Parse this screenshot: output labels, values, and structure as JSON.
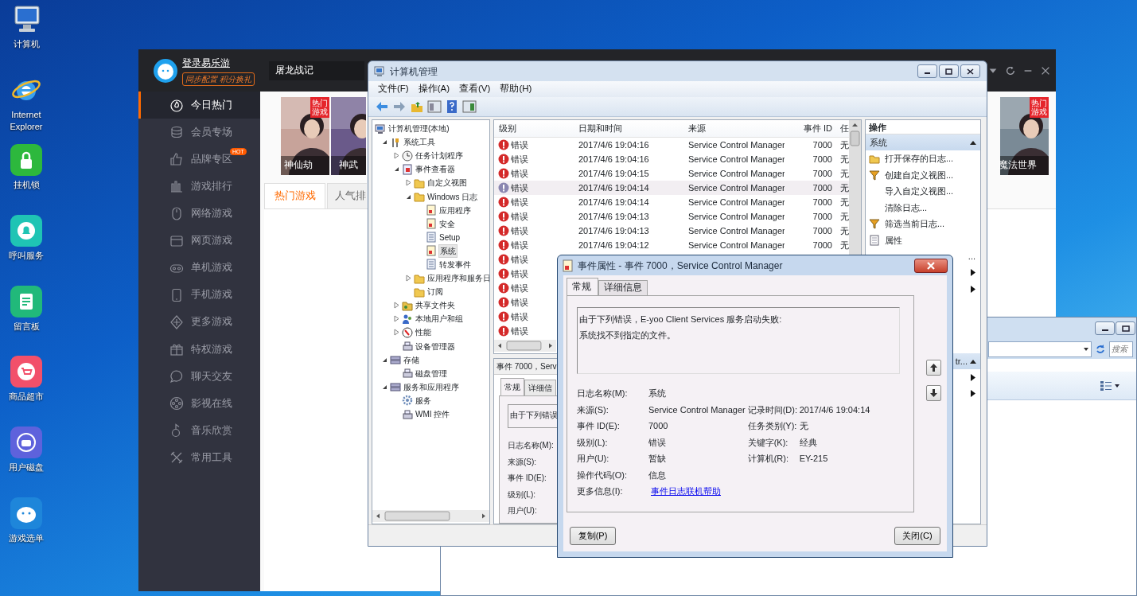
{
  "desktop_icons": [
    {
      "label": "计算机",
      "kind": "monitor"
    },
    {
      "label": "Internet Explorer",
      "kind": "browser"
    },
    {
      "label": "挂机锁",
      "kind": "tile",
      "color": "#2db83d"
    },
    {
      "label": "呼叫服务",
      "kind": "tile",
      "color": "#1fc4b4"
    },
    {
      "label": "留言板",
      "kind": "tile",
      "color": "#21b97a"
    },
    {
      "label": "商品超市",
      "kind": "tile",
      "color": "#f2506a"
    },
    {
      "label": "用户磁盘",
      "kind": "tile",
      "color": "#5e62dc"
    },
    {
      "label": "游戏选单",
      "kind": "tile",
      "color": "#1e86da"
    }
  ],
  "launcher": {
    "login": "登录易乐游",
    "slogan": "同步配置 积分换礼",
    "search": {
      "value": "屠龙战记"
    },
    "menu": [
      {
        "label": "今日热门",
        "selected": true
      },
      {
        "label": "会员专场",
        "selected": false
      },
      {
        "label": "品牌专区",
        "selected": false,
        "badge": "HOT"
      },
      {
        "label": "游戏排行",
        "selected": false
      },
      {
        "label": "网络游戏",
        "selected": false
      },
      {
        "label": "网页游戏",
        "selected": false
      },
      {
        "label": "单机游戏",
        "selected": false
      },
      {
        "label": "手机游戏",
        "selected": false
      },
      {
        "label": "更多游戏",
        "selected": false
      },
      {
        "label": "特权游戏",
        "selected": false
      },
      {
        "label": "聊天交友",
        "selected": false
      },
      {
        "label": "影视在线",
        "selected": false
      },
      {
        "label": "音乐欣赏",
        "selected": false
      },
      {
        "label": "常用工具",
        "selected": false
      }
    ],
    "games": [
      {
        "title": "神仙劫",
        "tag": "热门游戏",
        "color": "#c7a39a"
      },
      {
        "title": "神武",
        "color": "#6a5a8a"
      },
      {
        "title": "魔法世界",
        "tag": "热门游戏",
        "color": "#7a8a96"
      }
    ],
    "tabs": [
      {
        "label": "热门游戏",
        "selected": true
      },
      {
        "label": "人气排",
        "selected": false
      }
    ]
  },
  "explorer": {
    "search": {
      "placeholder": "搜索"
    }
  },
  "computer_management": {
    "title": "计算机管理",
    "menu": [
      "文件(F)",
      "操作(A)",
      "查看(V)",
      "帮助(H)"
    ],
    "tree": [
      {
        "label": "计算机管理(本地)",
        "kind": "computer",
        "selected": false,
        "children": [
          {
            "label": "系统工具",
            "kind": "tools",
            "expanded": true,
            "selected": false,
            "children": [
              {
                "label": "任务计划程序",
                "kind": "clock",
                "expanded": false,
                "selected": false
              },
              {
                "label": "事件查看器",
                "kind": "viewer",
                "expanded": true,
                "selected": false,
                "children": [
                  {
                    "label": "自定义视图",
                    "kind": "folder",
                    "expanded": false,
                    "selected": false
                  },
                  {
                    "label": "Windows 日志",
                    "kind": "folder",
                    "expanded": true,
                    "selected": false,
                    "children": [
                      {
                        "label": "应用程序",
                        "kind": "log",
                        "selected": false
                      },
                      {
                        "label": "安全",
                        "kind": "log",
                        "selected": false
                      },
                      {
                        "label": "Setup",
                        "kind": "list",
                        "selected": false
                      },
                      {
                        "label": "系统",
                        "kind": "log",
                        "selected": true
                      },
                      {
                        "label": "转发事件",
                        "kind": "list",
                        "selected": false
                      }
                    ]
                  },
                  {
                    "label": "应用程序和服务日",
                    "kind": "folder",
                    "expanded": false,
                    "selected": false
                  },
                  {
                    "label": "订阅",
                    "kind": "folder",
                    "selected": false
                  }
                ]
              },
              {
                "label": "共享文件夹",
                "kind": "share",
                "expanded": false,
                "selected": false
              },
              {
                "label": "本地用户和组",
                "kind": "users",
                "expanded": false,
                "selected": false
              },
              {
                "label": "性能",
                "kind": "perf",
                "expanded": false,
                "selected": false
              },
              {
                "label": "设备管理器",
                "kind": "device",
                "selected": false
              }
            ]
          },
          {
            "label": "存储",
            "kind": "storage",
            "expanded": true,
            "selected": false,
            "children": [
              {
                "label": "磁盘管理",
                "kind": "device",
                "selected": false
              }
            ]
          },
          {
            "label": "服务和应用程序",
            "kind": "storage",
            "expanded": true,
            "selected": false,
            "children": [
              {
                "label": "服务",
                "kind": "gear",
                "selected": false
              },
              {
                "label": "WMI 控件",
                "kind": "device",
                "selected": false
              }
            ]
          }
        ]
      }
    ],
    "events": {
      "columns": [
        "级别",
        "日期和时间",
        "来源",
        "事件 ID",
        "任"
      ],
      "rows": [
        {
          "level": "错误",
          "date": "2017/4/6 19:04:16",
          "source": "Service Control Manager",
          "id": "7000",
          "task": "无",
          "selected": false
        },
        {
          "level": "错误",
          "date": "2017/4/6 19:04:16",
          "source": "Service Control Manager",
          "id": "7000",
          "task": "无",
          "selected": false
        },
        {
          "level": "错误",
          "date": "2017/4/6 19:04:15",
          "source": "Service Control Manager",
          "id": "7000",
          "task": "无",
          "selected": false
        },
        {
          "level": "错误",
          "date": "2017/4/6 19:04:14",
          "source": "Service Control Manager",
          "id": "7000",
          "task": "无",
          "selected": true
        },
        {
          "level": "错误",
          "date": "2017/4/6 19:04:14",
          "source": "Service Control Manager",
          "id": "7000",
          "task": "无",
          "selected": false
        },
        {
          "level": "错误",
          "date": "2017/4/6 19:04:13",
          "source": "Service Control Manager",
          "id": "7000",
          "task": "无",
          "selected": false
        },
        {
          "level": "错误",
          "date": "2017/4/6 19:04:13",
          "source": "Service Control Manager",
          "id": "7000",
          "task": "无",
          "selected": false
        },
        {
          "level": "错误",
          "date": "2017/4/6 19:04:12",
          "source": "Service Control Manager",
          "id": "7000",
          "task": "无",
          "selected": false
        },
        {
          "level": "错误",
          "selected": false
        },
        {
          "level": "错误",
          "selected": false
        },
        {
          "level": "错误",
          "selected": false
        },
        {
          "level": "错误",
          "selected": false
        },
        {
          "level": "错误",
          "selected": false
        },
        {
          "level": "错误",
          "selected": false
        }
      ]
    },
    "detail": {
      "title": "事件 7000，Serv",
      "tabs": [
        {
          "label": "常规",
          "selected": true
        },
        {
          "label": "详细信",
          "selected": false
        }
      ],
      "message": "由于下列错误",
      "fields": [
        "日志名称(M):",
        "来源(S):",
        "事件 ID(E):",
        "级别(L):",
        "用户(U):"
      ]
    },
    "actions": {
      "header": "操作",
      "sections": [
        {
          "title": "系统",
          "expanded": true,
          "items": [
            {
              "label": "打开保存的日志...",
              "kind": "open"
            },
            {
              "label": "创建自定义视图...",
              "kind": "filter"
            },
            {
              "label": "导入自定义视图...",
              "kind": "plain"
            },
            {
              "label": "清除日志...",
              "kind": "plain"
            },
            {
              "label": "筛选当前日志...",
              "kind": "filter"
            },
            {
              "label": "属性",
              "kind": "props"
            },
            {
              "label": "...",
              "kind": "tail"
            },
            {
              "kind": "submenu"
            },
            {
              "kind": "submenu"
            }
          ]
        },
        {
          "title": "tr...",
          "expanded": true,
          "items": [
            {
              "kind": "submenu"
            },
            {
              "kind": "submenu"
            }
          ]
        }
      ]
    }
  },
  "dialog": {
    "title": "事件属性 - 事件 7000，Service Control Manager",
    "tabs": [
      {
        "label": "常规",
        "selected": true
      },
      {
        "label": "详细信息",
        "selected": false
      }
    ],
    "message": [
      "由于下列错误，E-yoo Client Services 服务启动失败:",
      "系统找不到指定的文件。"
    ],
    "fields": [
      {
        "label": "日志名称(M):",
        "value": "系统"
      },
      {
        "label": "来源(S):",
        "value": "Service Control Manager",
        "side": {
          "label": "记录时间(D):",
          "value": "2017/4/6 19:04:14"
        }
      },
      {
        "label": "事件 ID(E):",
        "value": "7000",
        "side": {
          "label": "任务类别(Y):",
          "value": "无"
        }
      },
      {
        "label": "级别(L):",
        "value": "错误",
        "side": {
          "label": "关键字(K):",
          "value": "经典"
        }
      },
      {
        "label": "用户(U):",
        "value": "暂缺",
        "side": {
          "label": "计算机(R):",
          "value": "EY-215"
        }
      },
      {
        "label": "操作代码(O):",
        "value": "信息"
      },
      {
        "label": "更多信息(I):",
        "value": "事件日志联机帮助",
        "kind": "link"
      }
    ],
    "buttons": [
      "复制(P)",
      "关闭(C)"
    ]
  }
}
